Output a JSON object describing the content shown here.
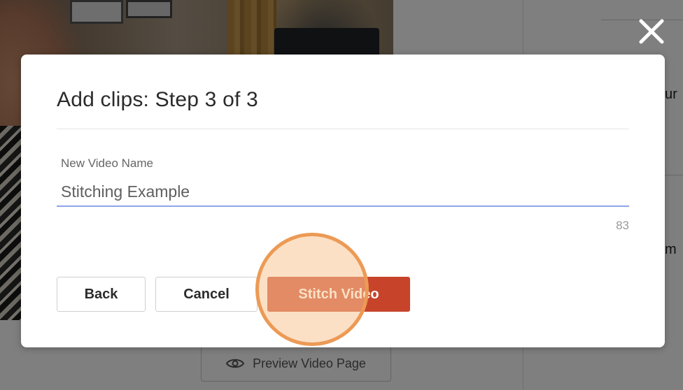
{
  "background": {
    "right_panel_fragments": [
      "ur",
      "m"
    ],
    "preview_button": {
      "label": "Preview Video Page",
      "icon": "eye-icon"
    }
  },
  "modal": {
    "title": "Add clips: Step 3 of 3",
    "field": {
      "label": "New Video Name",
      "value": "Stitching Example",
      "remaining_chars": "83"
    },
    "buttons": {
      "back": "Back",
      "cancel": "Cancel",
      "stitch": "Stitch Video"
    },
    "close_icon": "close-icon"
  },
  "colors": {
    "primary_button": "#c7442b",
    "input_underline": "#8fa6e6",
    "click_highlight": "#ec9a55"
  }
}
